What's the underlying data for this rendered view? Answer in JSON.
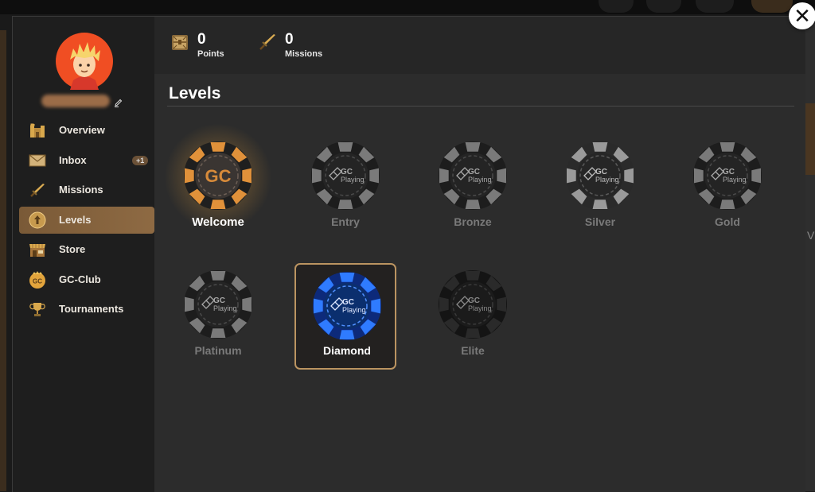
{
  "window": {
    "close_label": "✕"
  },
  "stats": {
    "points": {
      "value": "0",
      "label": "Points",
      "icon": "treasure-chest-icon"
    },
    "missions": {
      "value": "0",
      "label": "Missions",
      "icon": "sword-icon"
    }
  },
  "sidebar": {
    "items": [
      {
        "label": "Overview",
        "icon": "castle-icon"
      },
      {
        "label": "Inbox",
        "icon": "envelope-icon",
        "badge": "+1"
      },
      {
        "label": "Missions",
        "icon": "sword-icon"
      },
      {
        "label": "Levels",
        "icon": "level-up-icon",
        "active": true
      },
      {
        "label": "Store",
        "icon": "storefront-icon"
      },
      {
        "label": "GC-Club",
        "icon": "gc-club-icon",
        "icon_text": "GC"
      },
      {
        "label": "Tournaments",
        "icon": "trophy-icon"
      }
    ]
  },
  "levels": {
    "title": "Levels",
    "chip_logo_top": "GC",
    "chip_logo_bottom": "Playing",
    "current_logo": "GC",
    "items": [
      {
        "name": "Welcome",
        "state": "current"
      },
      {
        "name": "Entry",
        "state": "locked"
      },
      {
        "name": "Bronze",
        "state": "locked"
      },
      {
        "name": "Silver",
        "state": "locked"
      },
      {
        "name": "Gold",
        "state": "locked"
      },
      {
        "name": "Platinum",
        "state": "locked"
      },
      {
        "name": "Diamond",
        "state": "selected"
      },
      {
        "name": "Elite",
        "state": "locked"
      }
    ]
  },
  "colors": {
    "accent": "#8e6a43",
    "selected_border": "#bb9461",
    "welcome_chip": "#e0913a",
    "diamond_chip": "#1f5fe0"
  }
}
